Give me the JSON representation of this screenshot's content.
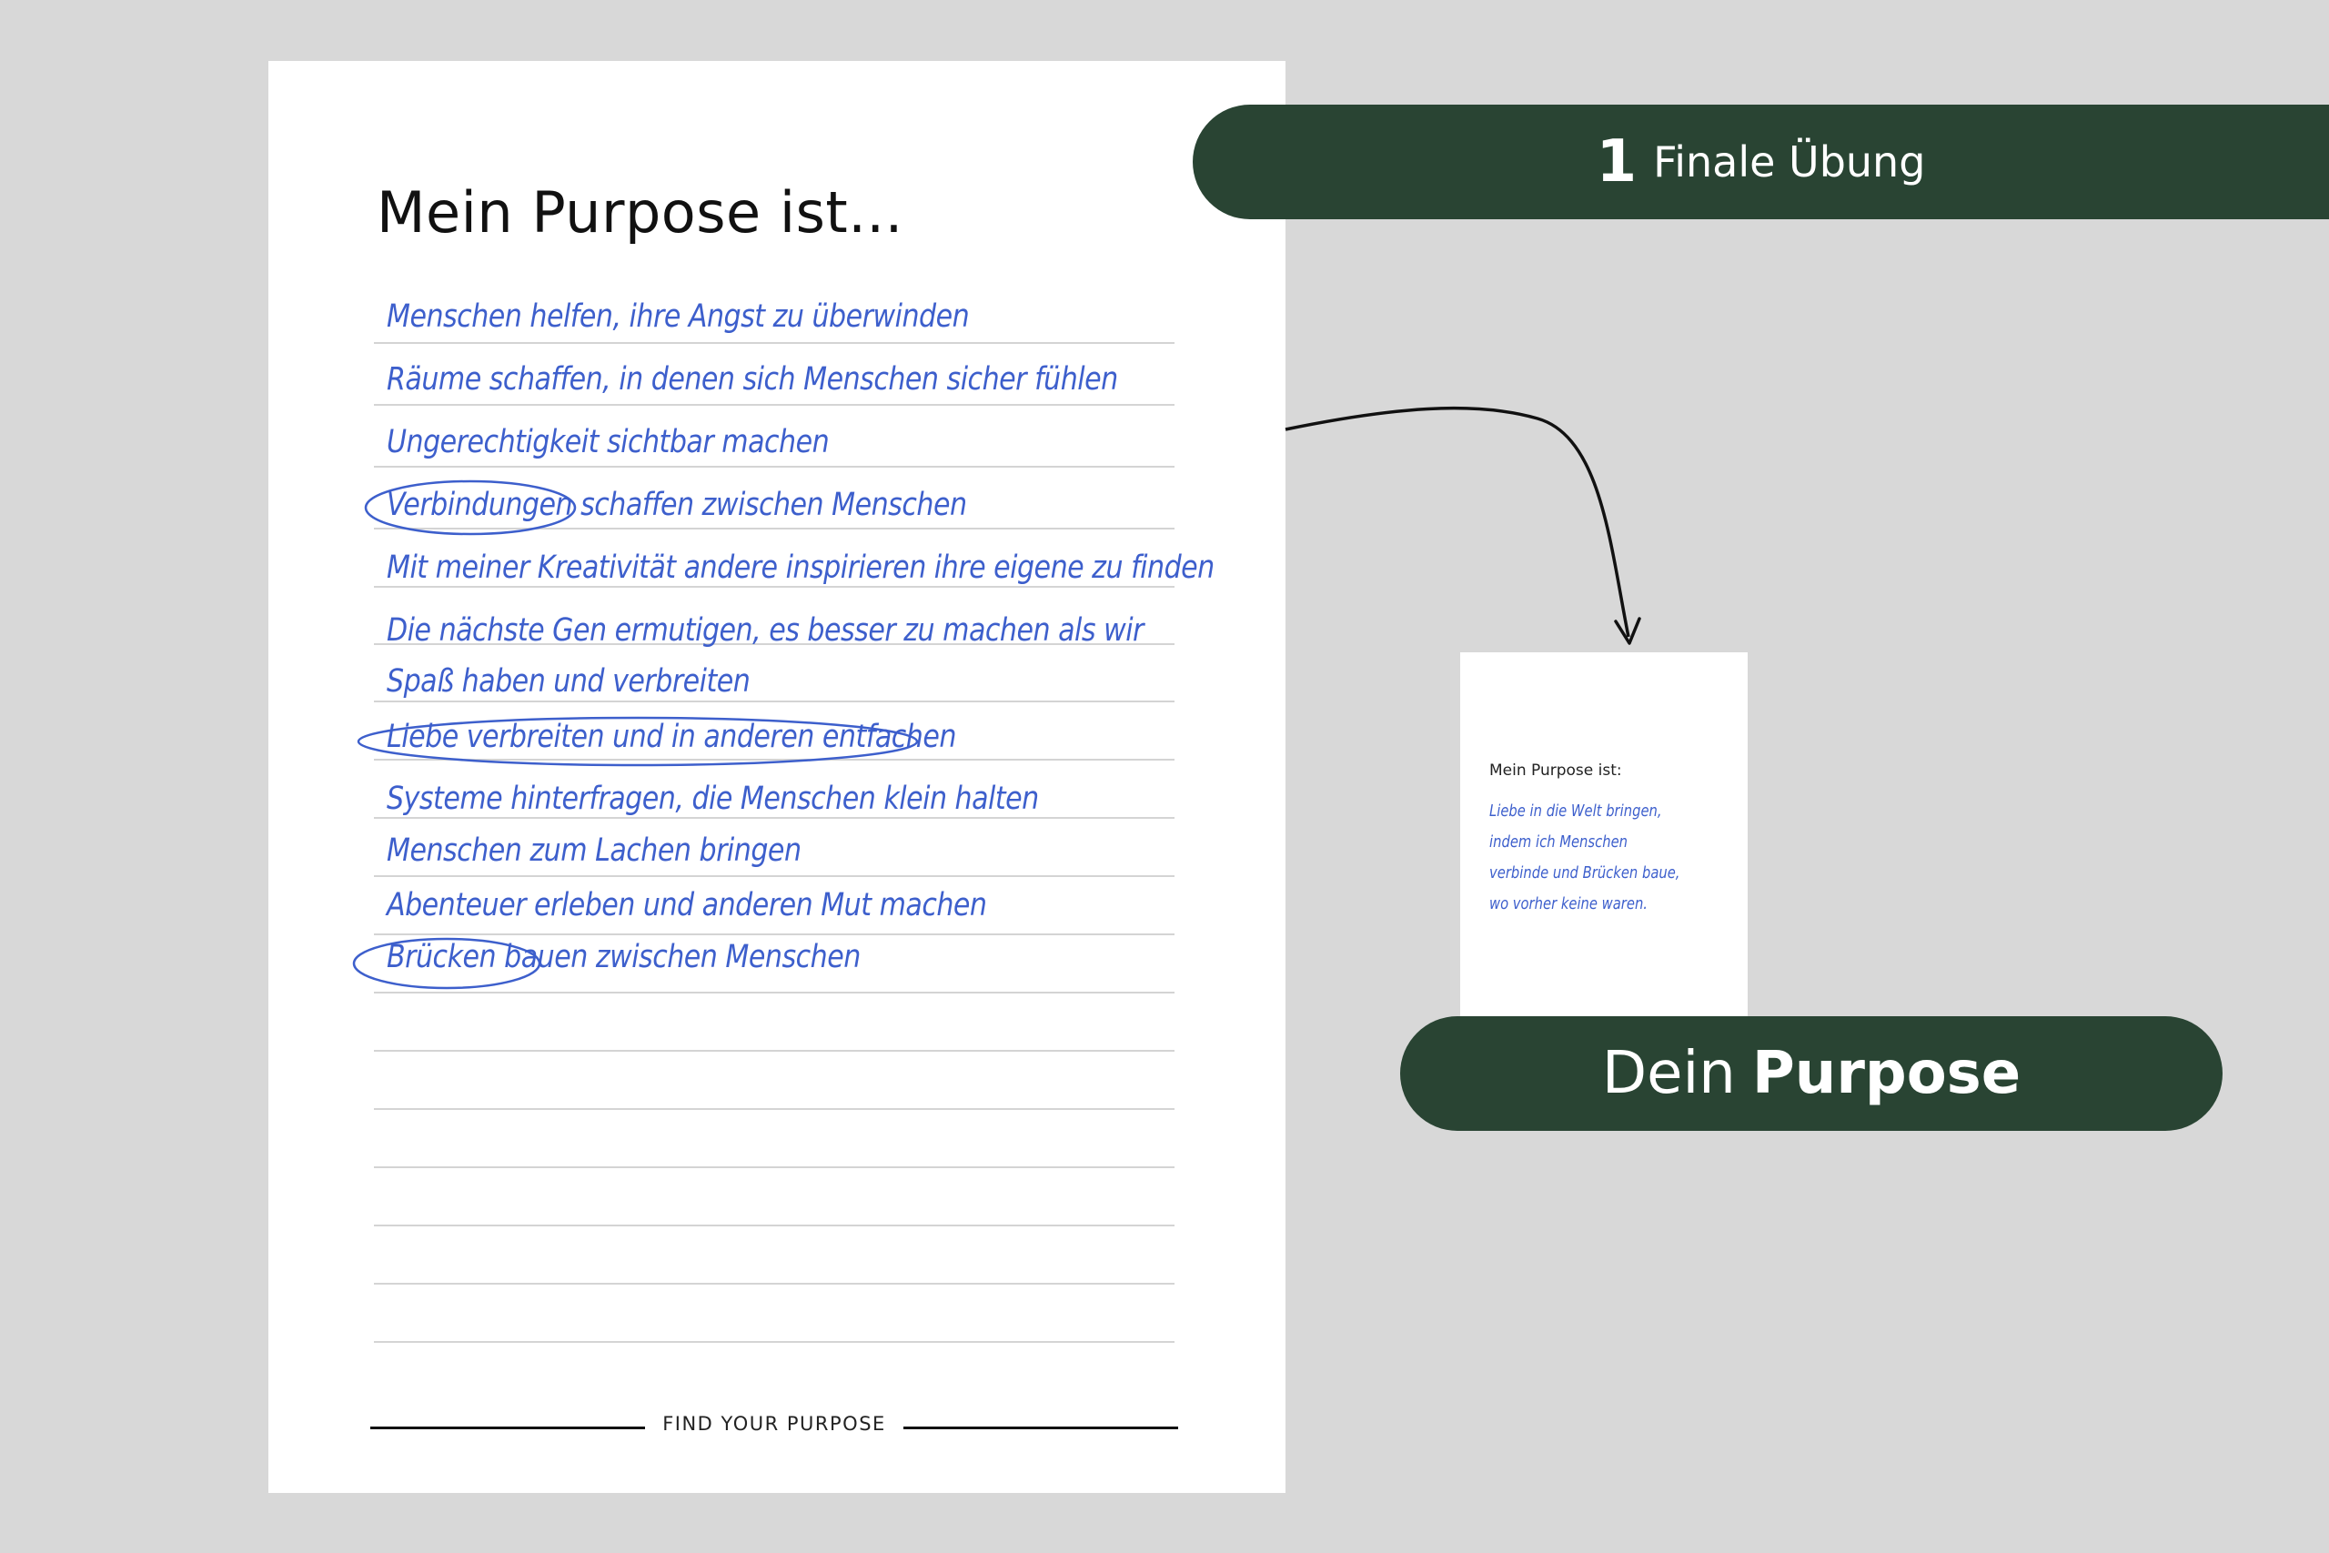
{
  "worksheet": {
    "title": "Mein Purpose ist...",
    "entries": [
      "Menschen helfen, ihre Angst zu überwinden",
      "Räume schaffen, in denen sich Menschen sicher fühlen",
      "Ungerechtigkeit sichtbar machen",
      "Verbindungen schaffen zwischen Menschen",
      "Mit meiner Kreativität andere inspirieren ihre eigene zu finden",
      "Die nächste Gen ermutigen, es besser zu machen als wir",
      "Spaß haben und verbreiten",
      "Liebe verbreiten und in anderen entfachen",
      "Systeme hinterfragen, die Menschen klein halten",
      "Menschen zum Lachen bringen",
      "Abenteuer erleben und anderen Mut machen",
      "Brücken bauen zwischen Menschen"
    ],
    "footer": "FIND YOUR PURPOSE"
  },
  "header_pill": {
    "number": "1",
    "label": "Finale Übung"
  },
  "result_card": {
    "title": "Mein Purpose ist:",
    "lines": [
      "Liebe in die Welt bringen,",
      "indem ich Menschen",
      "verbinde und Brücken baue,",
      "wo vorher keine waren."
    ]
  },
  "bottom_pill": {
    "prefix": "Dein",
    "bold": "Purpose"
  },
  "colors": {
    "background": "#d8d8d8",
    "pill": "#294433",
    "handwriting": "#3d5fcc"
  }
}
